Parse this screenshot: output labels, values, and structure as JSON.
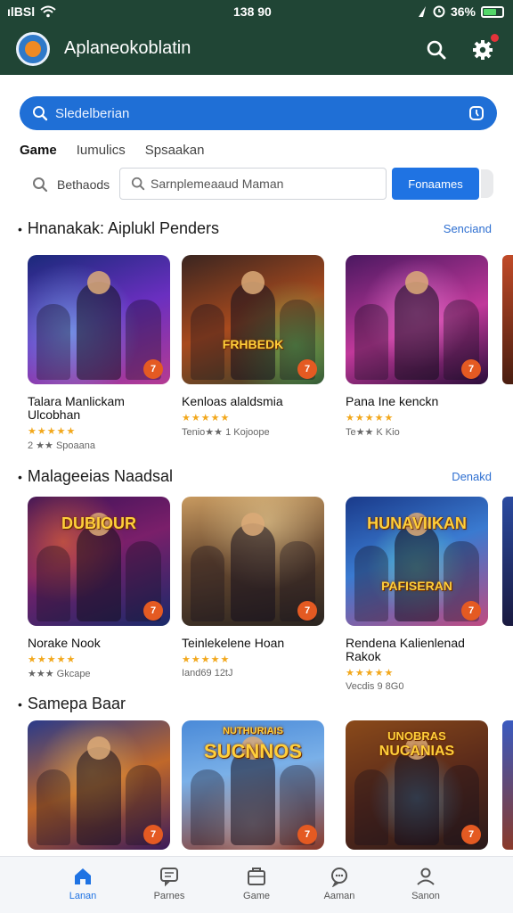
{
  "status": {
    "signal": "ılBSl",
    "time": "138 90",
    "battery": "36%"
  },
  "header": {
    "title": "Aplaneokoblatin"
  },
  "search": {
    "placeholder": "Sledelberian"
  },
  "tabs": [
    {
      "label": "Game"
    },
    {
      "label": "Iumulics"
    },
    {
      "label": "Spsaakan"
    }
  ],
  "filter": {
    "label": "Bethaods",
    "input_value": "Sarnplemeaaud Maman",
    "button_label": "Fonaames"
  },
  "sections": [
    {
      "title": "Hnanakak: Aiplukl Penders",
      "link": "Senciand",
      "cards": [
        {
          "name": "Talara Manlickam Ulcobhan",
          "stars": "★★★★★",
          "meta": "2 ★★ Spoaana"
        },
        {
          "name": "Kenloas alaldsmia",
          "stars": "★★★★★",
          "meta": "Tenio★★ 1 Kojoope"
        },
        {
          "name": "Pana Ine kenckn",
          "stars": "★★★★★",
          "meta": "Te★★ K Kio"
        }
      ]
    },
    {
      "title": "Malageeias Naadsal",
      "link": "Denakd",
      "cards": [
        {
          "name": "Norake Nook",
          "stars": "★★★★★",
          "meta": "★★★ Gkcape"
        },
        {
          "name": "Teinlekelene Hoan",
          "stars": "★★★★★",
          "meta": "Iand69 12tJ"
        },
        {
          "name": "Rendena Kalienlenad Rakok",
          "stars": "★★★★★",
          "meta": "Vecdis 9 8G0"
        }
      ]
    },
    {
      "title": "Samepa Baar",
      "link": "",
      "cards": [
        {
          "name": ""
        },
        {
          "name": ""
        },
        {
          "name": ""
        }
      ]
    }
  ],
  "card_art": {
    "s1c2_logo": "FRHBEDK",
    "s2c1_logo": "DUBIOUR",
    "s2c3_logo_top": "HUNAVIIKAN",
    "s2c3_logo": "PAFISERAN",
    "s3c2_logo_top": "NUTHURIAIS",
    "s3c2_logo": "SUCNNOS",
    "s3c3_logo_top": "UNOBRAS",
    "s3c3_logo": "NUCANIAS"
  },
  "bottom_nav": [
    {
      "label": "Lanan",
      "icon": "home-icon",
      "active": true
    },
    {
      "label": "Parnes",
      "icon": "chat-icon"
    },
    {
      "label": "Game",
      "icon": "briefcase-icon"
    },
    {
      "label": "Aaman",
      "icon": "chat-bubble-icon"
    },
    {
      "label": "Sanon",
      "icon": "user-icon"
    }
  ],
  "colors": {
    "header_bg": "#204535",
    "accent": "#1f73e3",
    "star": "#f2a81d",
    "badge": "#e45a22"
  }
}
